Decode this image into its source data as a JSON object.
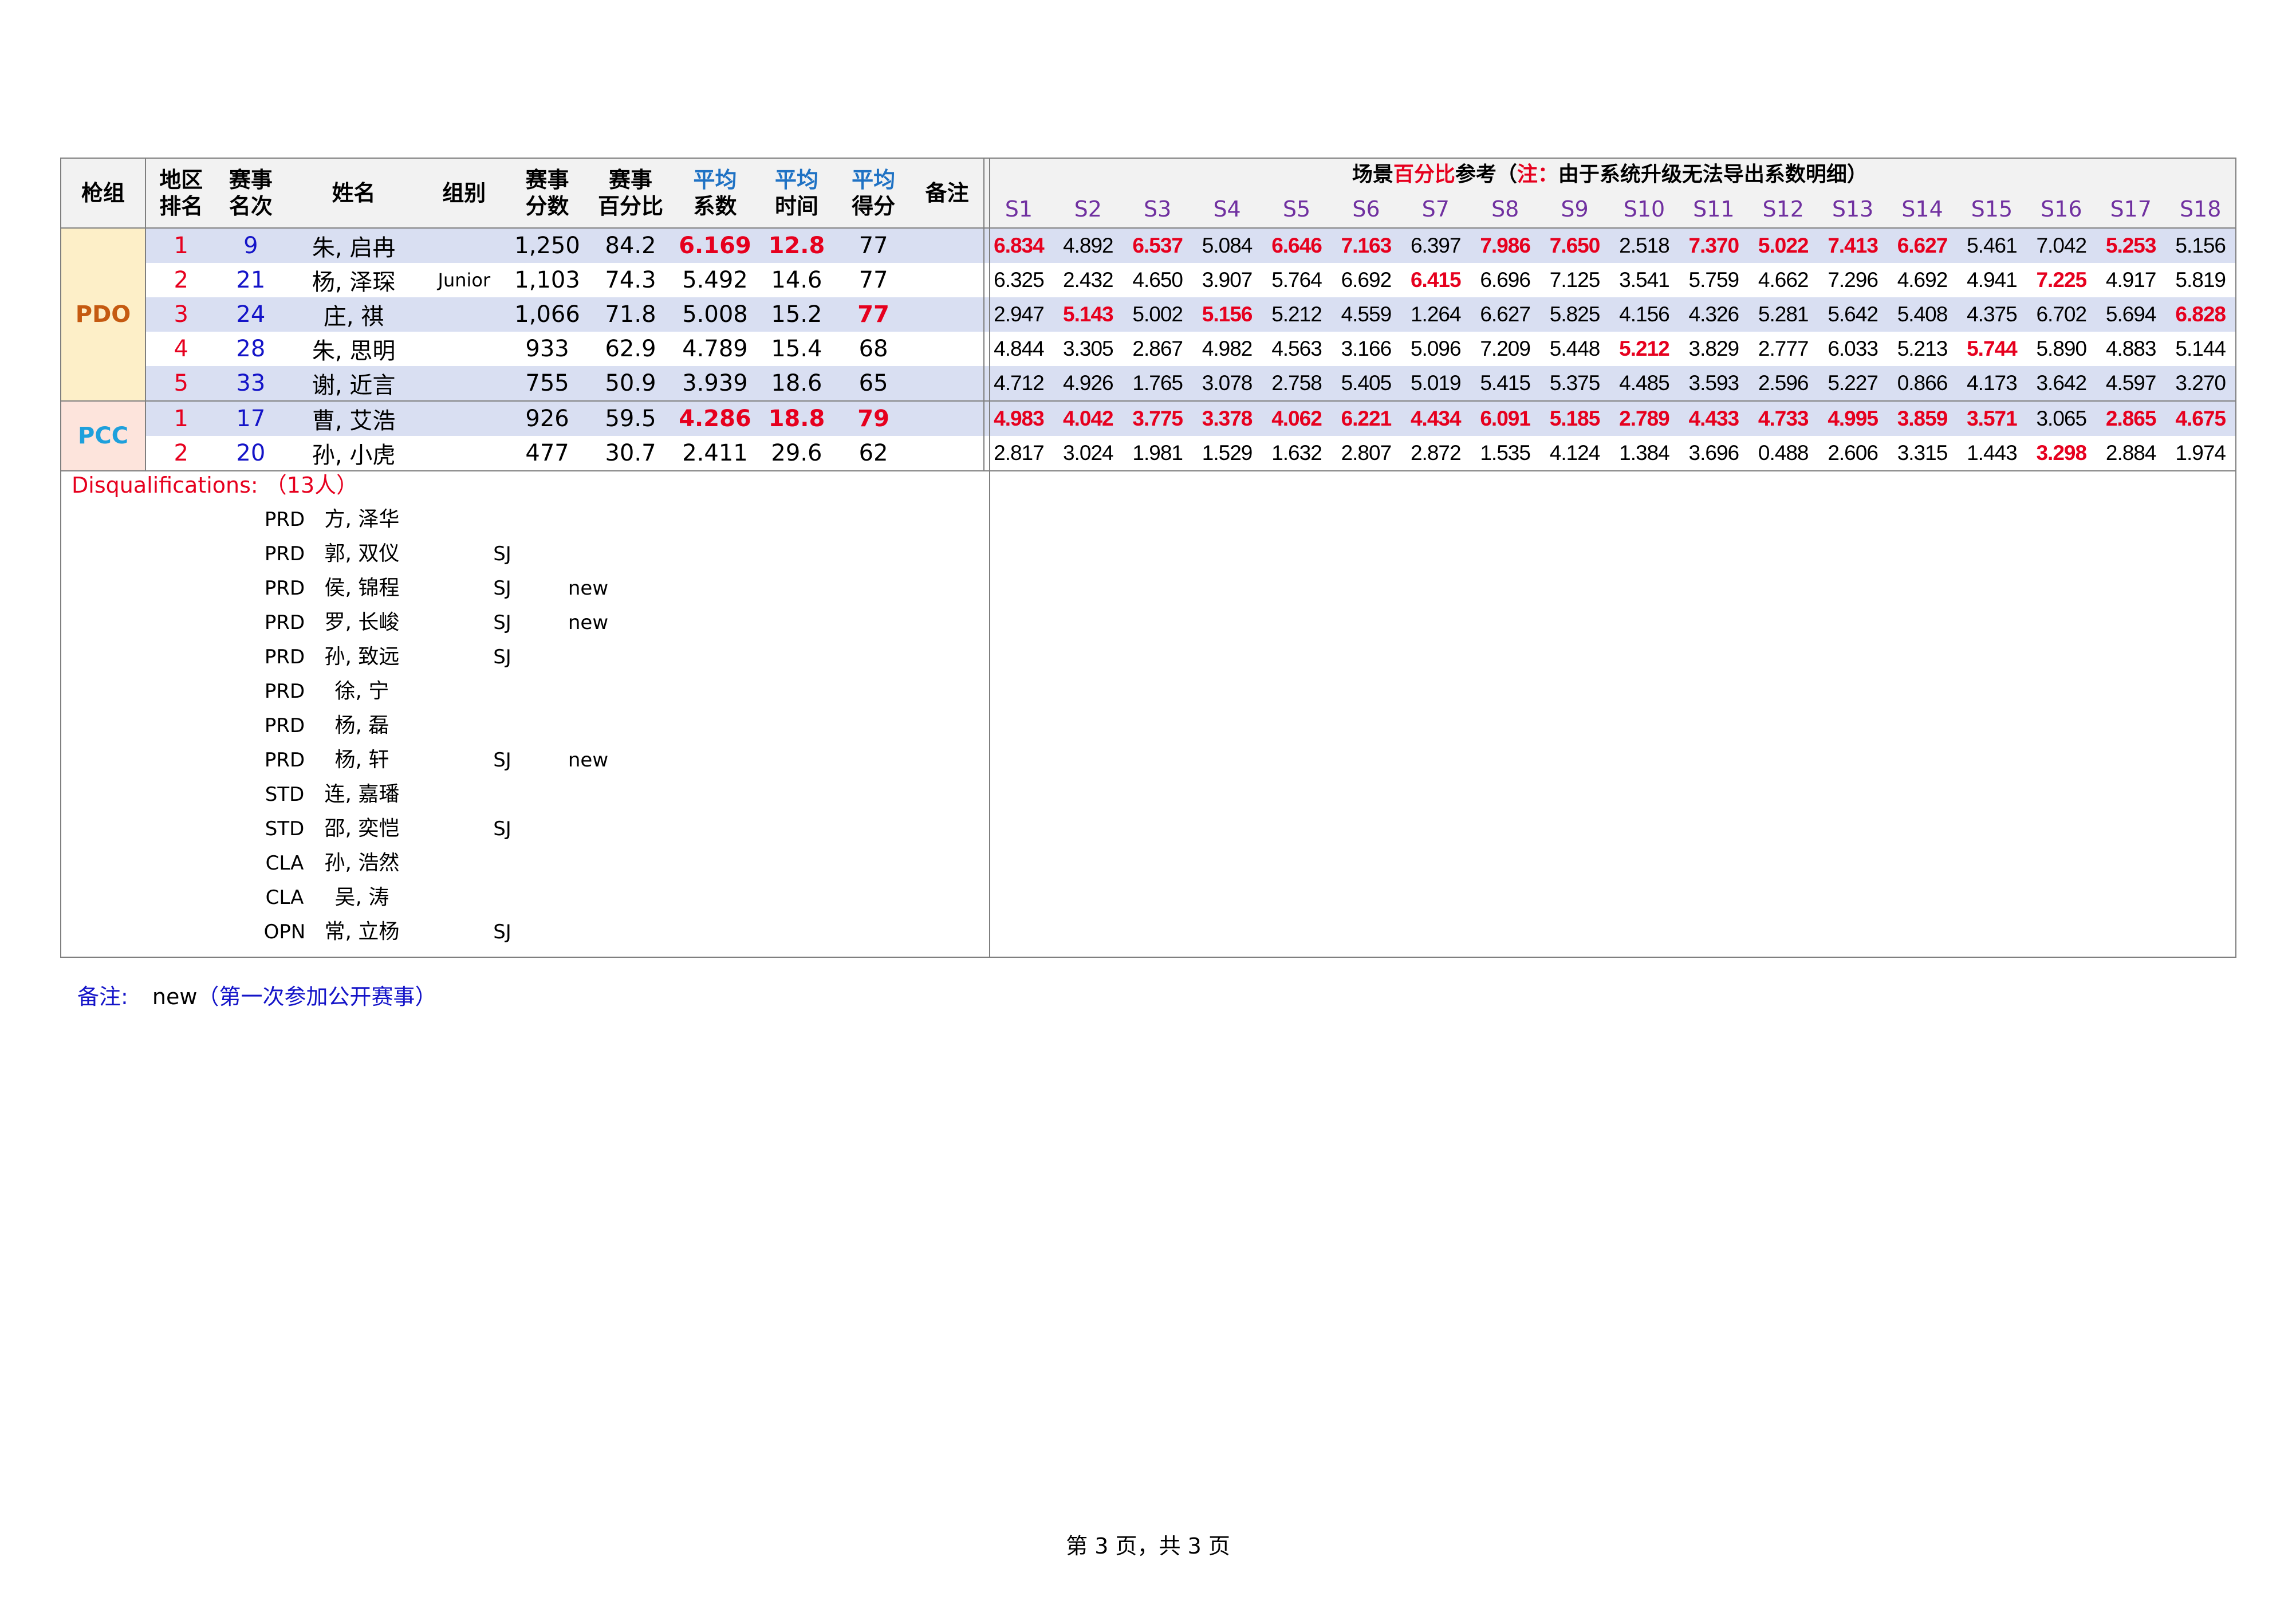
{
  "header": {
    "gun_group": "枪组",
    "region_rank_1": "地区",
    "region_rank_2": "排名",
    "match_rank_1": "赛事",
    "match_rank_2": "名次",
    "name": "姓名",
    "category": "组别",
    "match_score_1": "赛事",
    "match_score_2": "分数",
    "match_pct_1": "赛事",
    "match_pct_2": "百分比",
    "avg_hf_1": "平均",
    "avg_hf_2": "系数",
    "avg_time_1": "平均",
    "avg_time_2": "时间",
    "avg_pts_1": "平均",
    "avg_pts_2": "得分",
    "remark": "备注",
    "stage_title_a": "场景",
    "stage_title_b": "百分比",
    "stage_title_c": "参考（",
    "stage_title_d": "注：",
    "stage_title_e": "由于系统升级无法导出系数明细）"
  },
  "stages": [
    "S1",
    "S2",
    "S3",
    "S4",
    "S5",
    "S6",
    "S7",
    "S8",
    "S9",
    "S10",
    "S11",
    "S12",
    "S13",
    "S14",
    "S15",
    "S16",
    "S17",
    "S18"
  ],
  "groups": [
    {
      "name": "PDO",
      "rows": [
        {
          "rr": "1",
          "mr": "9",
          "name": "朱, 启冉",
          "cat": "",
          "score": "1,250",
          "pct": "84.2",
          "hf": "6.169",
          "time": "12.8",
          "pts": "77",
          "rem": "",
          "s": [
            "6.834",
            "4.892",
            "6.537",
            "5.084",
            "6.646",
            "7.163",
            "6.397",
            "7.986",
            "7.650",
            "2.518",
            "7.370",
            "5.022",
            "7.413",
            "6.627",
            "5.461",
            "7.042",
            "5.253",
            "5.156"
          ]
        },
        {
          "rr": "2",
          "mr": "21",
          "name": "杨, 泽琛",
          "cat": "Junior",
          "score": "1,103",
          "pct": "74.3",
          "hf": "5.492",
          "time": "14.6",
          "pts": "77",
          "rem": "",
          "s": [
            "6.325",
            "2.432",
            "4.650",
            "3.907",
            "5.764",
            "6.692",
            "6.415",
            "6.696",
            "7.125",
            "3.541",
            "5.759",
            "4.662",
            "7.296",
            "4.692",
            "4.941",
            "7.225",
            "4.917",
            "5.819"
          ]
        },
        {
          "rr": "3",
          "mr": "24",
          "name": "庄, 祺",
          "cat": "",
          "score": "1,066",
          "pct": "71.8",
          "hf": "5.008",
          "time": "15.2",
          "pts": "77",
          "rem": "",
          "s": [
            "2.947",
            "5.143",
            "5.002",
            "5.156",
            "5.212",
            "4.559",
            "1.264",
            "6.627",
            "5.825",
            "4.156",
            "4.326",
            "5.281",
            "5.642",
            "5.408",
            "4.375",
            "6.702",
            "5.694",
            "6.828"
          ]
        },
        {
          "rr": "4",
          "mr": "28",
          "name": "朱, 思明",
          "cat": "",
          "score": "933",
          "pct": "62.9",
          "hf": "4.789",
          "time": "15.4",
          "pts": "68",
          "rem": "",
          "s": [
            "4.844",
            "3.305",
            "2.867",
            "4.982",
            "4.563",
            "3.166",
            "5.096",
            "7.209",
            "5.448",
            "5.212",
            "3.829",
            "2.777",
            "6.033",
            "5.213",
            "5.744",
            "5.890",
            "4.883",
            "5.144"
          ]
        },
        {
          "rr": "5",
          "mr": "33",
          "name": "谢, 近言",
          "cat": "",
          "score": "755",
          "pct": "50.9",
          "hf": "3.939",
          "time": "18.6",
          "pts": "65",
          "rem": "",
          "s": [
            "4.712",
            "4.926",
            "1.765",
            "3.078",
            "2.758",
            "5.405",
            "5.019",
            "5.415",
            "5.375",
            "4.485",
            "3.593",
            "2.596",
            "5.227",
            "0.866",
            "4.173",
            "3.642",
            "4.597",
            "3.270"
          ]
        }
      ]
    },
    {
      "name": "PCC",
      "rows": [
        {
          "rr": "1",
          "mr": "17",
          "name": "曹, 艾浩",
          "cat": "",
          "score": "926",
          "pct": "59.5",
          "hf": "4.286",
          "time": "18.8",
          "pts": "79",
          "rem": "",
          "s": [
            "4.983",
            "4.042",
            "3.775",
            "3.378",
            "4.062",
            "6.221",
            "4.434",
            "6.091",
            "5.185",
            "2.789",
            "4.433",
            "4.733",
            "4.995",
            "3.859",
            "3.571",
            "3.065",
            "2.865",
            "4.675"
          ]
        },
        {
          "rr": "2",
          "mr": "20",
          "name": "孙, 小虎",
          "cat": "",
          "score": "477",
          "pct": "30.7",
          "hf": "2.411",
          "time": "29.6",
          "pts": "62",
          "rem": "",
          "s": [
            "2.817",
            "3.024",
            "1.981",
            "1.529",
            "1.632",
            "2.807",
            "2.872",
            "1.535",
            "4.124",
            "1.384",
            "3.696",
            "0.488",
            "2.606",
            "3.315",
            "1.443",
            "3.298",
            "2.884",
            "1.974"
          ]
        }
      ]
    }
  ],
  "disqualifications": {
    "title": "Disqualifications: （13人）",
    "rows": [
      {
        "div": "PRD",
        "name": "方, 泽华",
        "cat": "",
        "note": ""
      },
      {
        "div": "PRD",
        "name": "郭, 双仪",
        "cat": "SJ",
        "note": ""
      },
      {
        "div": "PRD",
        "name": "侯, 锦程",
        "cat": "SJ",
        "note": "new"
      },
      {
        "div": "PRD",
        "name": "罗, 长峻",
        "cat": "SJ",
        "note": "new"
      },
      {
        "div": "PRD",
        "name": "孙, 致远",
        "cat": "SJ",
        "note": ""
      },
      {
        "div": "PRD",
        "name": "徐, 宁",
        "cat": "",
        "note": ""
      },
      {
        "div": "PRD",
        "name": "杨, 磊",
        "cat": "",
        "note": ""
      },
      {
        "div": "PRD",
        "name": "杨, 轩",
        "cat": "SJ",
        "note": "new"
      },
      {
        "div": "STD",
        "name": "连, 嘉璠",
        "cat": "",
        "note": ""
      },
      {
        "div": "STD",
        "name": "邵, 奕恺",
        "cat": "SJ",
        "note": ""
      },
      {
        "div": "CLA",
        "name": "孙, 浩然",
        "cat": "",
        "note": ""
      },
      {
        "div": "CLA",
        "name": "吴, 涛",
        "cat": "",
        "note": ""
      },
      {
        "div": "OPN",
        "name": "常, 立杨",
        "cat": "SJ",
        "note": ""
      }
    ]
  },
  "note": {
    "label": "备注:",
    "key": "new",
    "desc": "（第一次参加公开赛事）"
  },
  "footer": "第 3 页，共 3 页",
  "highlights": {
    "hf": [
      [
        0,
        0
      ],
      [
        1,
        0
      ]
    ],
    "time": [
      [
        0,
        0
      ],
      [
        1,
        0
      ]
    ],
    "pts": [
      [
        0,
        2
      ],
      [
        1,
        0
      ]
    ],
    "stage_bold_red": {
      "0-0": [
        0,
        2,
        4,
        5,
        7,
        8,
        10,
        11,
        12,
        13,
        16
      ],
      "0-1": [
        6,
        15
      ],
      "0-2": [
        1,
        3,
        17
      ],
      "0-3": [
        9,
        14
      ],
      "0-4": [],
      "1-0": [
        0,
        1,
        2,
        3,
        4,
        5,
        6,
        7,
        8,
        9,
        10,
        11,
        12,
        13,
        14,
        16,
        17
      ],
      "1-1": [
        15
      ]
    }
  },
  "colors": {
    "red": "#e6001e",
    "blue": "#1414c8",
    "purple": "#7030a0",
    "pdo_bg": "#fdefc8",
    "pcc_bg": "#fde4dc",
    "row_shade": "#d9dff2"
  }
}
